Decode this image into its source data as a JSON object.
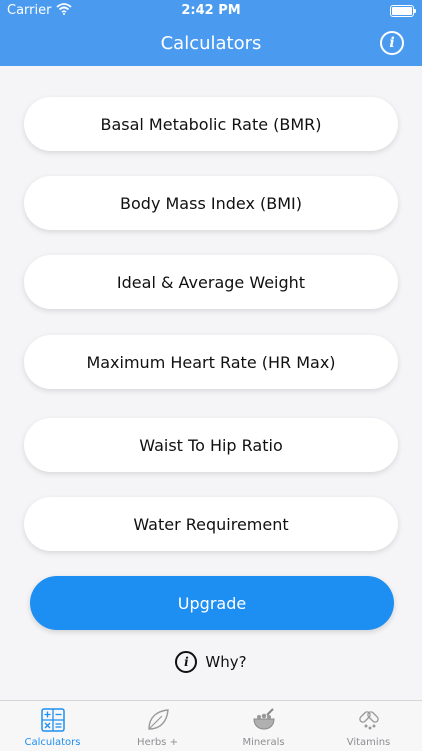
{
  "status": {
    "carrier": "Carrier",
    "time": "2:42 PM"
  },
  "header": {
    "title": "Calculators"
  },
  "buttons": [
    "Basal Metabolic Rate (BMR)",
    "Body Mass Index (BMI)",
    "Ideal & Average Weight",
    "Maximum Heart Rate (HR Max)",
    "Waist To Hip Ratio",
    "Water Requirement"
  ],
  "upgrade": {
    "label": "Upgrade"
  },
  "why": {
    "label": "Why?"
  },
  "tabs": [
    {
      "label": "Calculators",
      "icon": "calculator-icon",
      "active": true
    },
    {
      "label": "Herbs +",
      "icon": "leaf-icon",
      "active": false
    },
    {
      "label": "Minerals",
      "icon": "mortar-bowl-icon",
      "active": false
    },
    {
      "label": "Vitamins",
      "icon": "pills-icon",
      "active": false
    }
  ],
  "colors": {
    "header": "#4a9bf0",
    "accent": "#1e8ff2",
    "background": "#f5f5f7"
  }
}
